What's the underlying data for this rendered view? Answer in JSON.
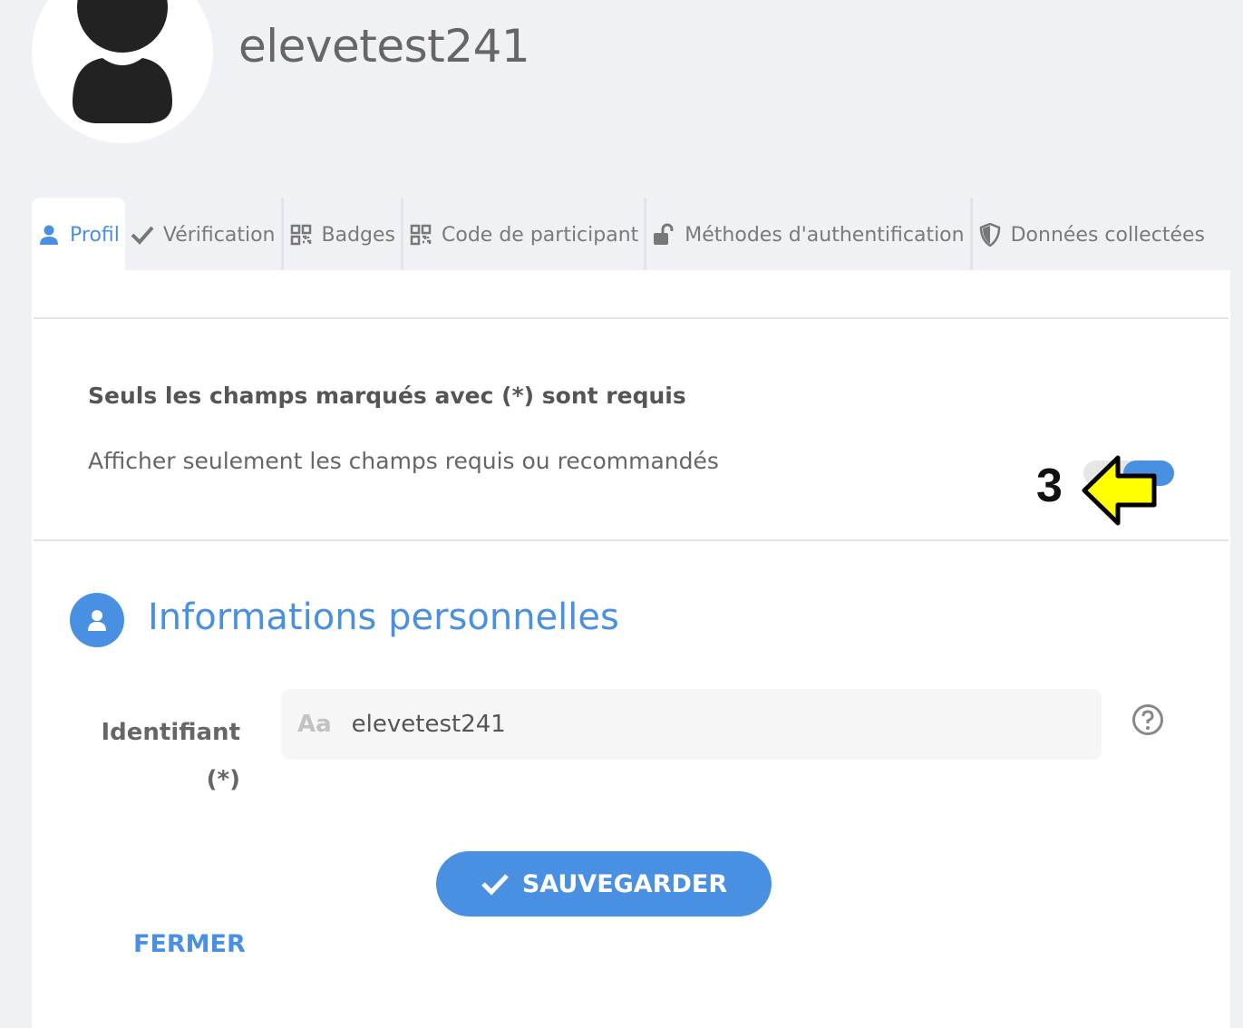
{
  "user": {
    "username": "elevetest241"
  },
  "tabs": [
    {
      "label": "Profil",
      "icon": "user-icon",
      "active": true
    },
    {
      "label": "Vérification",
      "icon": "check-icon"
    },
    {
      "label": "Badges",
      "icon": "qr-code-icon"
    },
    {
      "label": "Code de participant",
      "icon": "qr-code-icon"
    },
    {
      "label": "Méthodes d'authentification",
      "icon": "unlock-icon"
    },
    {
      "label": "Données collectées",
      "icon": "shield-icon"
    }
  ],
  "form": {
    "required_note": "Seuls les champs marqués avec (*) sont requis",
    "filter_label": "Afficher seulement les champs requis ou recommandés",
    "filter_on": true,
    "section_title": "Informations personnelles",
    "field_label": "Identifiant",
    "field_required": "(*)",
    "field_type_marker": "Aa",
    "field_value": "elevetest241"
  },
  "annotation": {
    "number": "3",
    "color": "#ffff00"
  },
  "actions": {
    "save": "SAUVEGARDER",
    "close": "FERMER"
  },
  "colors": {
    "accent": "#4a90e2",
    "background": "#eff1f5"
  }
}
